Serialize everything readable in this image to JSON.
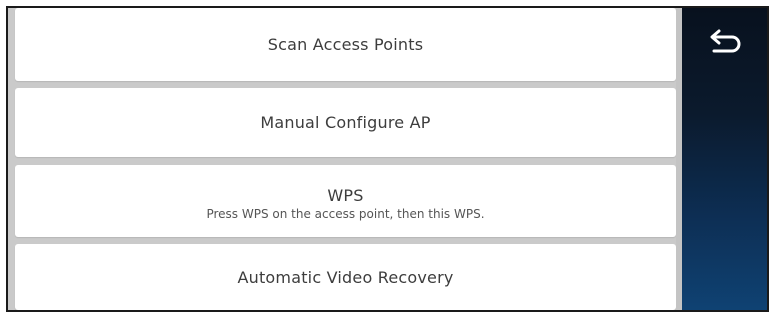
{
  "menu": {
    "items": [
      {
        "label": "Scan Access Points"
      },
      {
        "label": "Manual Configure AP"
      },
      {
        "label": "WPS",
        "sublabel": "Press WPS on the access point, then this WPS."
      },
      {
        "label": "Automatic Video Recovery"
      }
    ]
  },
  "side_panel": {
    "back_icon": "back-arrow-icon"
  },
  "colors": {
    "panel_top": "#08111e",
    "panel_bottom": "#0f4273",
    "item_background": "#ffffff",
    "gutter": "#cacaca",
    "text": "#3d3d3d"
  }
}
